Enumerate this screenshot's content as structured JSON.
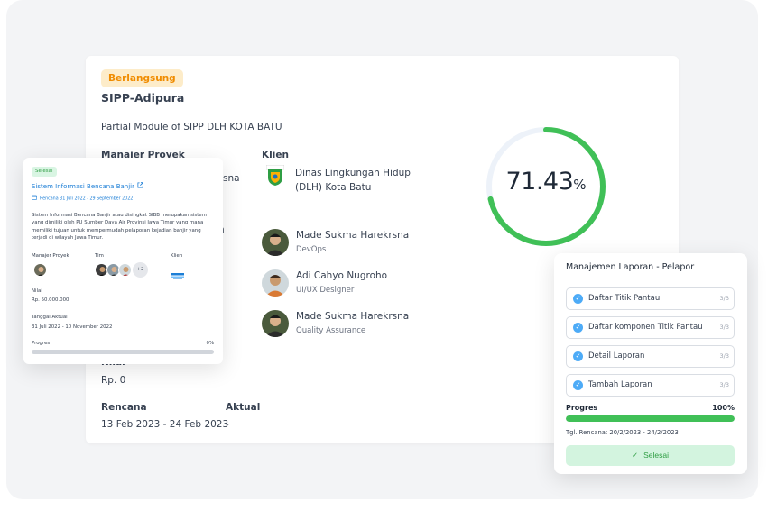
{
  "project": {
    "status": "Berlangsung",
    "name": "SIPP-Adipura",
    "description": "Partial Module of SIPP DLH KOTA BATU",
    "manager_label": "Manajer Proyek",
    "manager_partial": "sna",
    "client_label": "Klien",
    "client_name": "Dinas Lingkungan Hidup (DLH) Kota Batu",
    "team_partial": "n",
    "team": [
      {
        "name": "Made Sukma Harekrsna",
        "role": "DevOps"
      },
      {
        "name": "Adi Cahyo Nugroho",
        "role": "UI/UX Designer"
      },
      {
        "name": "Made Sukma Harekrsna",
        "role": "Quality Assurance"
      }
    ],
    "value_label": "Nilai",
    "value": "Rp. 0",
    "plan_label": "Rencana",
    "plan_value": "13 Feb 2023 - 24 Feb 2023",
    "actual_label": "Aktual",
    "actual_value": "-",
    "progress_number": "71.43",
    "progress_unit": "%",
    "progress_fraction": 0.7143
  },
  "card_left": {
    "status": "Selesai",
    "title": "Sistem Informasi Bencana Banjir",
    "dates": "Rencana 31 Juli 2022 - 29 September 2022",
    "description": "Sistem Informasi Bencana Banjir atau disingkat SIBB merupakan sistem yang dimiliki oleh PU Sumber Daya Air Provinsi Jawa Timur yang mana memiliki tujuan untuk mempermudah pelaporan kejadian banjir yang terjadi di wilayah Jawa Timur.",
    "manager_label": "Manajer Proyek",
    "team_label": "Tim",
    "team_more": "+2",
    "client_label": "Klien",
    "value_label": "Nilai",
    "value": "Rp. 50.000.000",
    "actual_label": "Tanggal Aktual",
    "actual_value": "31 Juli 2022 - 10 November 2022",
    "progress_label": "Progres",
    "progress_value": "0%",
    "progress_fraction": 0
  },
  "card_right": {
    "title": "Manajemen Laporan - Pelapor",
    "tasks": [
      {
        "label": "Daftar Titik Pantau",
        "count": "3/3"
      },
      {
        "label": "Daftar komponen Titik Pantau",
        "count": "3/3"
      },
      {
        "label": "Detail Laporan",
        "count": "3/3"
      },
      {
        "label": "Tambah Laporan",
        "count": "3/3"
      }
    ],
    "progress_label": "Progres",
    "progress_value": "100%",
    "progress_fraction": 1,
    "plan_dates": "Tgl. Rencana: 20/2/2023 - 24/2/2023",
    "done_button": "Selesai"
  },
  "colors": {
    "accent_green": "#40c057",
    "badge_orange_bg": "#fdecc9",
    "badge_orange_text": "#f08c00",
    "link_blue": "#1c7ed6",
    "check_blue": "#4dabf7"
  }
}
